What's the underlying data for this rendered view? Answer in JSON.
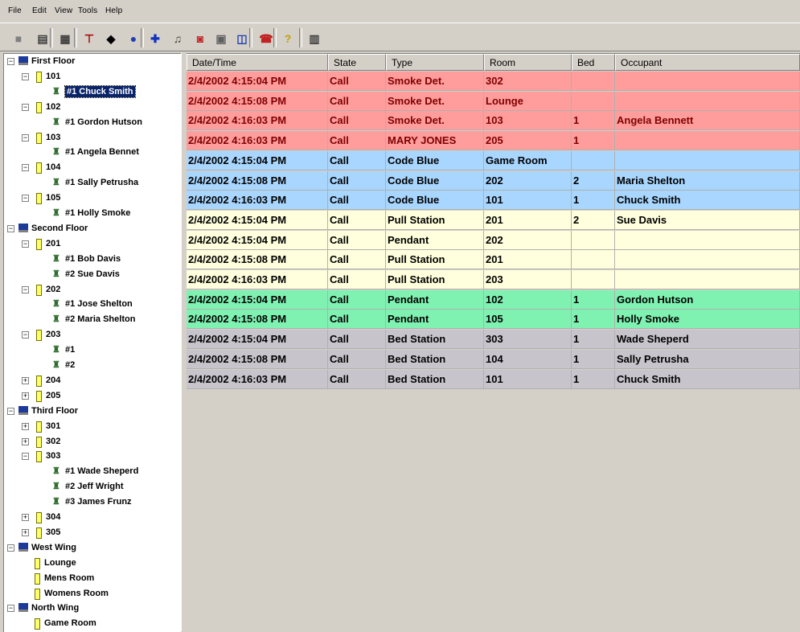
{
  "menu": [
    {
      "label": "File"
    },
    {
      "label": "Edit"
    },
    {
      "label": "View"
    },
    {
      "label": "Tools"
    },
    {
      "label": "Help"
    }
  ],
  "toolbar": [
    {
      "name": "gray-square-icon",
      "glyph": "■",
      "color": "#808080"
    },
    {
      "name": "printer-icon",
      "glyph": "▤",
      "color": "#404040"
    },
    {
      "name": "preview-icon",
      "glyph": "▦",
      "color": "#404040"
    },
    {
      "name": "filter-icon",
      "glyph": "⊤",
      "color": "#aa0000"
    },
    {
      "name": "pointer-icon",
      "glyph": "◆",
      "color": "#000000"
    },
    {
      "name": "globe-icon",
      "glyph": "●",
      "color": "#2040b0"
    },
    {
      "name": "add-icon",
      "glyph": "✚",
      "color": "#1030c0"
    },
    {
      "name": "bell-icon",
      "glyph": "♫",
      "color": "#404040"
    },
    {
      "name": "alarm-icon",
      "glyph": "◙",
      "color": "#c02020"
    },
    {
      "name": "window-icon",
      "glyph": "▣",
      "color": "#606060"
    },
    {
      "name": "chart-icon",
      "glyph": "◫",
      "color": "#2040b0"
    },
    {
      "name": "phone-icon",
      "glyph": "☎",
      "color": "#c02020"
    },
    {
      "name": "help-icon",
      "glyph": "?",
      "color": "#c0a000"
    },
    {
      "name": "book-icon",
      "glyph": "▥",
      "color": "#404040"
    }
  ],
  "tree": [
    {
      "type": "floor",
      "label": "First Floor",
      "level": 0,
      "exp": "−"
    },
    {
      "type": "room",
      "label": "101",
      "level": 1,
      "exp": "−"
    },
    {
      "type": "bed",
      "label": "#1 Chuck Smith",
      "level": 2,
      "selected": true
    },
    {
      "type": "room",
      "label": "102",
      "level": 1,
      "exp": "−"
    },
    {
      "type": "bed",
      "label": "#1 Gordon Hutson",
      "level": 2
    },
    {
      "type": "room",
      "label": "103",
      "level": 1,
      "exp": "−"
    },
    {
      "type": "bed",
      "label": "#1 Angela Bennet",
      "level": 2
    },
    {
      "type": "room",
      "label": "104",
      "level": 1,
      "exp": "−"
    },
    {
      "type": "bed",
      "label": "#1 Sally Petrusha",
      "level": 2
    },
    {
      "type": "room",
      "label": "105",
      "level": 1,
      "exp": "−"
    },
    {
      "type": "bed",
      "label": "#1 Holly Smoke",
      "level": 2
    },
    {
      "type": "floor",
      "label": "Second Floor",
      "level": 0,
      "exp": "−"
    },
    {
      "type": "room",
      "label": "201",
      "level": 1,
      "exp": "−"
    },
    {
      "type": "bed",
      "label": "#1 Bob Davis",
      "level": 2
    },
    {
      "type": "bed",
      "label": "#2 Sue Davis",
      "level": 2
    },
    {
      "type": "room",
      "label": "202",
      "level": 1,
      "exp": "−"
    },
    {
      "type": "bed",
      "label": "#1 Jose Shelton",
      "level": 2
    },
    {
      "type": "bed",
      "label": "#2 Maria Shelton",
      "level": 2
    },
    {
      "type": "room",
      "label": "203",
      "level": 1,
      "exp": "−"
    },
    {
      "type": "bed",
      "label": "#1",
      "level": 2
    },
    {
      "type": "bed",
      "label": "#2",
      "level": 2
    },
    {
      "type": "room",
      "label": "204",
      "level": 1,
      "exp": "+"
    },
    {
      "type": "room",
      "label": "205",
      "level": 1,
      "exp": "+"
    },
    {
      "type": "floor",
      "label": "Third Floor",
      "level": 0,
      "exp": "−"
    },
    {
      "type": "room",
      "label": "301",
      "level": 1,
      "exp": "+"
    },
    {
      "type": "room",
      "label": "302",
      "level": 1,
      "exp": "+"
    },
    {
      "type": "room",
      "label": "303",
      "level": 1,
      "exp": "−"
    },
    {
      "type": "bed",
      "label": "#1 Wade Sheperd",
      "level": 2
    },
    {
      "type": "bed",
      "label": "#2 Jeff Wright",
      "level": 2
    },
    {
      "type": "bed",
      "label": "#3 James Frunz",
      "level": 2
    },
    {
      "type": "room",
      "label": "304",
      "level": 1,
      "exp": "+"
    },
    {
      "type": "room",
      "label": "305",
      "level": 1,
      "exp": "+"
    },
    {
      "type": "floor",
      "label": "West Wing",
      "level": 0,
      "exp": "−"
    },
    {
      "type": "room",
      "label": "Lounge",
      "level": 1,
      "exp": ""
    },
    {
      "type": "room",
      "label": "Mens Room",
      "level": 1,
      "exp": ""
    },
    {
      "type": "room",
      "label": "Womens Room",
      "level": 1,
      "exp": ""
    },
    {
      "type": "floor",
      "label": "North Wing",
      "level": 0,
      "exp": "−"
    },
    {
      "type": "room",
      "label": "Game Room",
      "level": 1,
      "exp": ""
    }
  ],
  "grid": {
    "columns": [
      "Date/Time",
      "State",
      "Type",
      "Room",
      "Bed",
      "Occupant"
    ],
    "colors": {
      "smoke": "#ff9d9d",
      "blue": "#a8d6ff",
      "pull": "#ffffdd",
      "pendant": "#7ff2b2",
      "bed": "#c8c4cc",
      "text_red": "#800000",
      "text_black": "#000000"
    },
    "rows": [
      {
        "dt": "2/4/2002 4:15:04 PM",
        "state": "Call",
        "type": "Smoke Det.",
        "room": "302",
        "bed": "",
        "occ": "",
        "color": "smoke",
        "ink": "text_red"
      },
      {
        "dt": "2/4/2002 4:15:08 PM",
        "state": "Call",
        "type": "Smoke Det.",
        "room": "Lounge",
        "bed": "",
        "occ": "",
        "color": "smoke",
        "ink": "text_red"
      },
      {
        "dt": "2/4/2002 4:16:03 PM",
        "state": "Call",
        "type": "Smoke Det.",
        "room": "103",
        "bed": "1",
        "occ": "Angela Bennett",
        "color": "smoke",
        "ink": "text_red"
      },
      {
        "dt": "2/4/2002 4:16:03 PM",
        "state": "Call",
        "type": "MARY JONES",
        "room": "205",
        "bed": "1",
        "occ": "",
        "color": "smoke",
        "ink": "text_red"
      },
      {
        "dt": "2/4/2002 4:15:04 PM",
        "state": "Call",
        "type": "Code Blue",
        "room": "Game Room",
        "bed": "",
        "occ": "",
        "color": "blue",
        "ink": "text_black"
      },
      {
        "dt": "2/4/2002 4:15:08 PM",
        "state": "Call",
        "type": "Code Blue",
        "room": "202",
        "bed": "2",
        "occ": "Maria Shelton",
        "color": "blue",
        "ink": "text_black"
      },
      {
        "dt": "2/4/2002 4:16:03 PM",
        "state": "Call",
        "type": "Code Blue",
        "room": "101",
        "bed": "1",
        "occ": "Chuck Smith",
        "color": "blue",
        "ink": "text_black"
      },
      {
        "dt": "2/4/2002 4:15:04 PM",
        "state": "Call",
        "type": "Pull Station",
        "room": "201",
        "bed": "2",
        "occ": "Sue Davis",
        "color": "pull",
        "ink": "text_black"
      },
      {
        "dt": "2/4/2002 4:15:04 PM",
        "state": "Call",
        "type": "Pendant",
        "room": "202",
        "bed": "",
        "occ": "",
        "color": "pull",
        "ink": "text_black"
      },
      {
        "dt": "2/4/2002 4:15:08 PM",
        "state": "Call",
        "type": "Pull Station",
        "room": "201",
        "bed": "",
        "occ": "",
        "color": "pull",
        "ink": "text_black"
      },
      {
        "dt": "2/4/2002 4:16:03 PM",
        "state": "Call",
        "type": "Pull Station",
        "room": "203",
        "bed": "",
        "occ": "",
        "color": "pull",
        "ink": "text_black"
      },
      {
        "dt": "2/4/2002 4:15:04 PM",
        "state": "Call",
        "type": "Pendant",
        "room": "102",
        "bed": "1",
        "occ": "Gordon Hutson",
        "color": "pendant",
        "ink": "text_black"
      },
      {
        "dt": "2/4/2002 4:15:08 PM",
        "state": "Call",
        "type": "Pendant",
        "room": "105",
        "bed": "1",
        "occ": "Holly Smoke",
        "color": "pendant",
        "ink": "text_black"
      },
      {
        "dt": "2/4/2002 4:15:04 PM",
        "state": "Call",
        "type": "Bed Station",
        "room": "303",
        "bed": "1",
        "occ": "Wade Sheperd",
        "color": "bed",
        "ink": "text_black"
      },
      {
        "dt": "2/4/2002 4:15:08 PM",
        "state": "Call",
        "type": "Bed Station",
        "room": "104",
        "bed": "1",
        "occ": "Sally Petrusha",
        "color": "bed",
        "ink": "text_black"
      },
      {
        "dt": "2/4/2002 4:16:03 PM",
        "state": "Call",
        "type": "Bed Station",
        "room": "101",
        "bed": "1",
        "occ": "Chuck Smith",
        "color": "bed",
        "ink": "text_black"
      }
    ]
  }
}
